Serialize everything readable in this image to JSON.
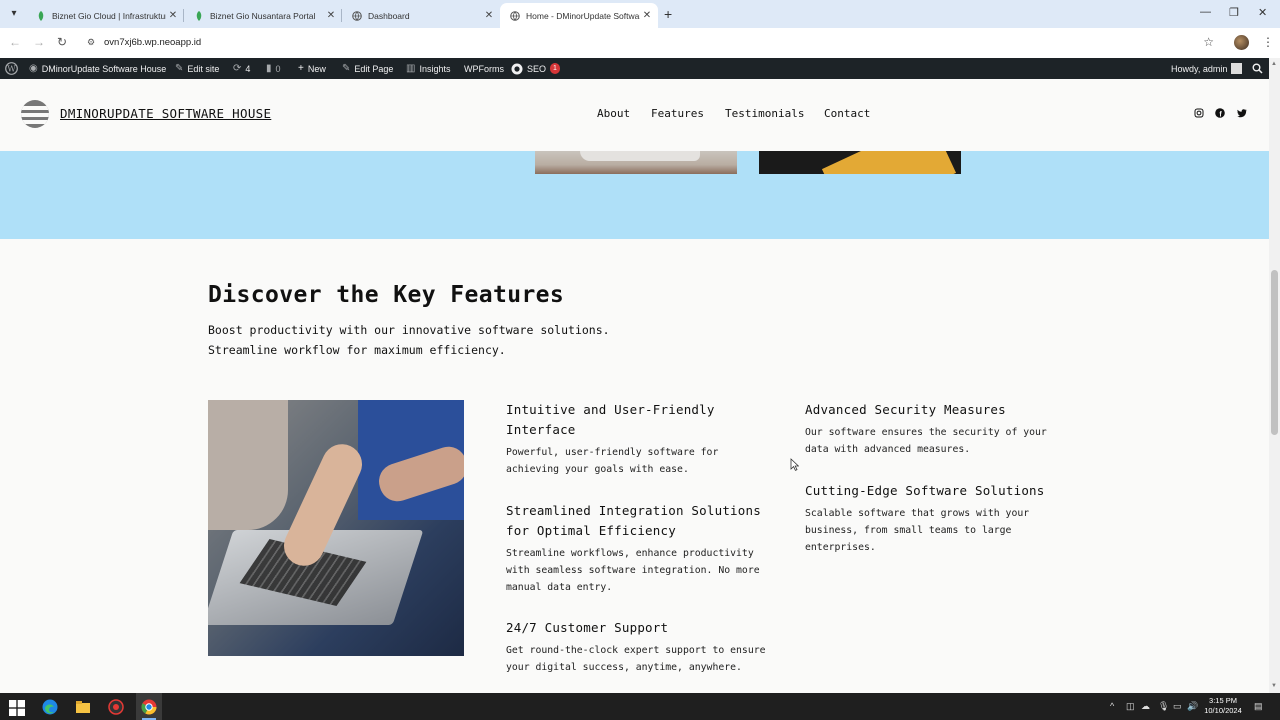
{
  "browser": {
    "tabs": [
      {
        "title": "Biznet Gio Cloud | Infrastruktur",
        "active": false
      },
      {
        "title": "Biznet Gio Nusantara Portal",
        "active": false
      },
      {
        "title": "Dashboard",
        "active": false
      },
      {
        "title": "Home - DMinorUpdate Software",
        "active": true
      }
    ],
    "url": "ovn7xj6b.wp.neoapp.id"
  },
  "adminbar": {
    "site_name": "DMinorUpdate Software House",
    "edit_site": "Edit site",
    "updates_count": "4",
    "comments_count": "0",
    "new": "New",
    "edit_page": "Edit Page",
    "insights": "Insights",
    "wpforms": "WPForms",
    "seo": "SEO",
    "seo_badge": "1",
    "howdy": "Howdy, admin"
  },
  "site": {
    "title": "DMINORUPDATE SOFTWARE HOUSE",
    "nav": [
      "About",
      "Features",
      "Testimonials",
      "Contact"
    ],
    "social_icons": [
      "instagram-icon",
      "facebook-icon",
      "twitter-icon"
    ]
  },
  "features_section": {
    "title": "Discover the Key Features",
    "subtitle_line1": "Boost productivity with our innovative software solutions.",
    "subtitle_line2": "Streamline workflow for maximum efficiency.",
    "items": [
      {
        "title": "Intuitive and User-Friendly Interface",
        "desc": "Powerful, user-friendly software for achieving your goals with ease."
      },
      {
        "title": "Streamlined Integration Solutions for Optimal Efficiency",
        "desc": "Streamline workflows, enhance productivity with seamless software integration. No more manual data entry."
      },
      {
        "title": "24/7 Customer Support",
        "desc": "Get round-the-clock expert support to ensure your digital success, anytime, anywhere."
      },
      {
        "title": "Advanced Security Measures",
        "desc": "Our software ensures the security of your data with advanced measures."
      },
      {
        "title": "Cutting-Edge Software Solutions",
        "desc": "Scalable software that grows with your business, from small teams to large enterprises."
      }
    ]
  },
  "taskbar": {
    "time": "3:15 PM",
    "date": "10/10/2024"
  },
  "colors": {
    "hero_band": "#afe0f8",
    "adminbar": "#1d2327",
    "page_bg": "#fafaf9"
  }
}
